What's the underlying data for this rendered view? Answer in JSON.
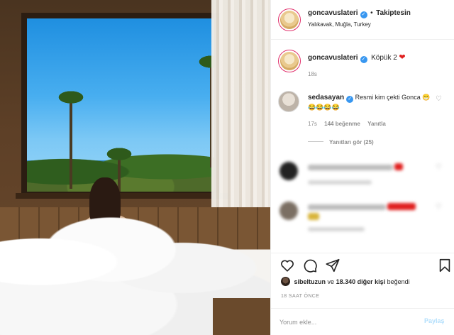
{
  "post": {
    "author": "goncavuslateri",
    "follow_status": "Takiptesin",
    "location": "Yalıkavak, Muğla, Turkey",
    "caption": "Köpük 2",
    "caption_time": "18s"
  },
  "comments": [
    {
      "user": "sedasayan",
      "text": "Resmi kim çekti Gonca",
      "emojis": "😁😂😂😂😂",
      "time": "17s",
      "likes": "144 beğenme",
      "reply": "Yanıtla",
      "view_replies": "Yanıtları gör (25)"
    }
  ],
  "likes": {
    "user": "sibeltuzun",
    "connector": "ve",
    "count_text": "18.340 diğer kişi",
    "suffix": "beğendi"
  },
  "timestamp": "18 SAAT ÖNCE",
  "comment_box": {
    "placeholder": "Yorum ekle...",
    "share_label": "Paylaş"
  },
  "colors": {
    "accent_blue": "#0095f6",
    "verified_blue": "#3897f0",
    "heart_red": "#e0201f",
    "muted": "#8e8e8e"
  },
  "icons": [
    "verified-icon",
    "heart-icon",
    "comment-icon",
    "share-icon",
    "bookmark-icon",
    "more-icon"
  ]
}
